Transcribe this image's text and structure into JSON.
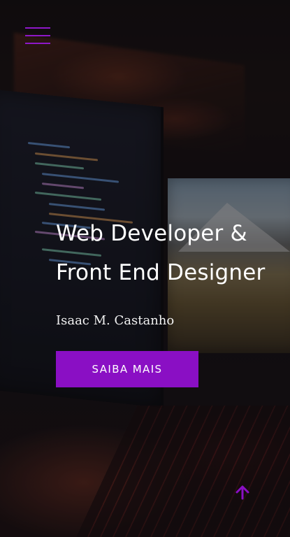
{
  "hero": {
    "title_line1": "Web Developer &",
    "title_line2": "Front End Designer",
    "subtitle": "Isaac M. Castanho",
    "cta_label": "SAIBA MAIS"
  },
  "icons": {
    "menu": "hamburger-menu-icon",
    "back_to_top": "arrow-up-icon"
  },
  "colors": {
    "accent": "#8a0fc4",
    "text": "#ffffff"
  }
}
